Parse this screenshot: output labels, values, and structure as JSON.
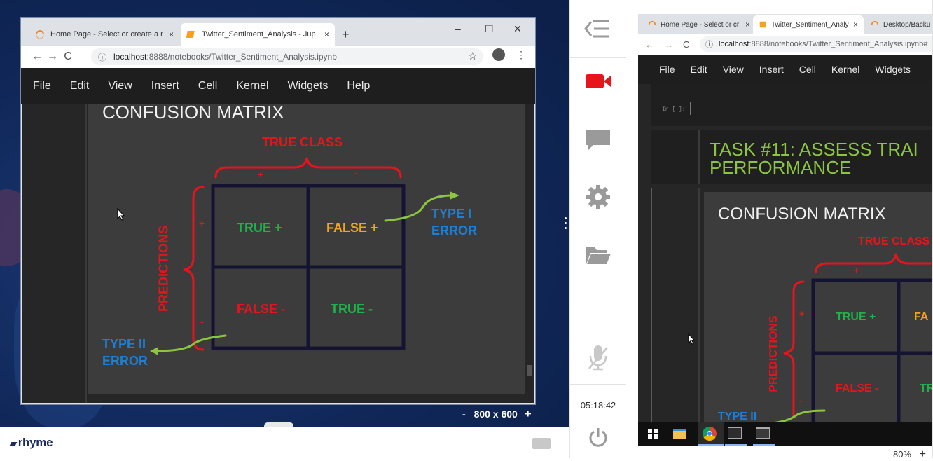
{
  "left_window": {
    "tabs": [
      {
        "label": "Home Page - Select or create a n",
        "close": "×"
      },
      {
        "label": "Twitter_Sentiment_Analysis - Jup",
        "close": "×"
      }
    ],
    "new_tab": "+",
    "window_controls": [
      "–",
      "☐",
      "✕"
    ],
    "url_host": "localhost",
    "url_path": ":8888/notebooks/Twitter_Sentiment_Analysis.ipynb",
    "menu": [
      "File",
      "Edit",
      "View",
      "Insert",
      "Cell",
      "Kernel",
      "Widgets",
      "Help"
    ],
    "resolution": {
      "minus": "-",
      "value": "800 x 600",
      "plus": "+"
    }
  },
  "slide": {
    "title": "CONFUSION MATRIX",
    "true_class": "TRUE CLASS",
    "plus": "+",
    "minus": "-",
    "predictions": "PREDICTIONS",
    "cells": [
      "TRUE +",
      "FALSE +",
      "FALSE -",
      "TRUE -"
    ],
    "type_one_a": "TYPE I",
    "type_one_b": "ERROR",
    "type_two_a": "TYPE II",
    "type_two_b": "ERROR"
  },
  "colors": {
    "red": "#e8141c",
    "green": "#1fb24a",
    "orange": "#f5a31a",
    "blue": "#1e7fd6",
    "arrow": "#8cc63f",
    "task": "#8cc63f"
  },
  "sidebar": {
    "icons": [
      "collapse-menu-icon",
      "video-camera-icon",
      "chat-icon",
      "gear-icon",
      "folder-icon",
      "microphone-muted-icon",
      "power-icon"
    ],
    "timer": "05:18:42"
  },
  "right_window": {
    "tabs": [
      {
        "label": "Home Page - Select or cr",
        "close": "×"
      },
      {
        "label": "Twitter_Sentiment_Analy",
        "close": "×"
      },
      {
        "label": "Desktop/Backu",
        "close": ""
      }
    ],
    "url_host": "localhost",
    "url_path": ":8888/notebooks/Twitter_Sentiment_Analysis.ipynb#",
    "menu": [
      "File",
      "Edit",
      "View",
      "Insert",
      "Cell",
      "Kernel",
      "Widgets"
    ],
    "cell_prompt": "In [ ]:",
    "task_line1": "TASK #11: ASSESS TRAI",
    "task_line2": "PERFORMANCE",
    "slide_title": "CONFUSION MATRIX",
    "true_class": "TRUE CLASS",
    "predictions": "PREDICTIONS",
    "cells": [
      "TRUE +",
      "FA",
      "FALSE -",
      "TR"
    ],
    "type_two": "TYPE II",
    "zoom": {
      "minus": "-",
      "value": "80%",
      "plus": "+"
    }
  },
  "brand": "rhyme"
}
